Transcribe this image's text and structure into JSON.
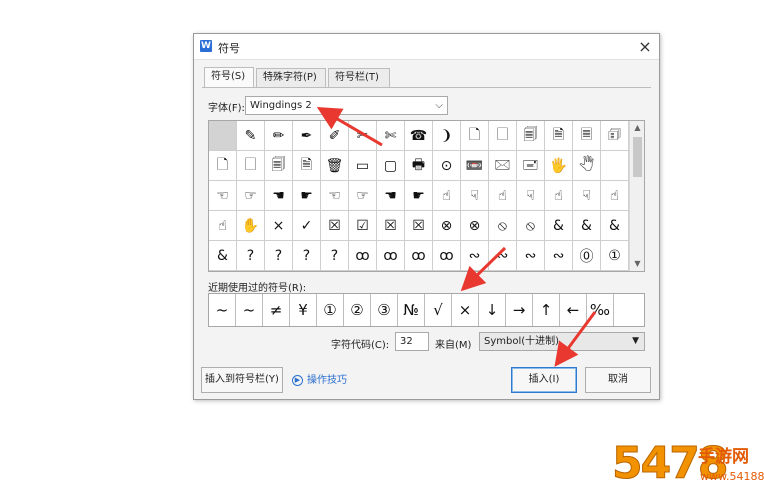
{
  "dialog": {
    "app_icon": "W",
    "title": "符号",
    "close_label": "×"
  },
  "tabs": [
    {
      "label": "符号(S)",
      "active": true
    },
    {
      "label": "特殊字符(P)",
      "active": false
    },
    {
      "label": "符号栏(T)",
      "active": false
    }
  ],
  "font": {
    "label": "字体(F):",
    "value": "Wingdings 2"
  },
  "symbol_grid": {
    "rows": [
      [
        "",
        "✎",
        "✏",
        "✒",
        "✐",
        "✂",
        "✄",
        "☎",
        "❩",
        "🗋",
        "🗌",
        "🗐",
        "🗎",
        "🗏",
        "🗊"
      ],
      [
        "🗋",
        "🗌",
        "🗐",
        "🗎",
        "🗑",
        "▭",
        "▢",
        "🖶",
        "⊙",
        "📼",
        "🖂",
        "🖃",
        "🖐",
        "🖑",
        ""
      ],
      [
        "☜",
        "☞",
        "☚",
        "☛",
        "☜",
        "☞",
        "☚",
        "☛",
        "☝",
        "☟",
        "☝",
        "☟",
        "☝",
        "☟",
        "☝"
      ],
      [
        "☝",
        "✋",
        "×",
        "✓",
        "☒",
        "☑",
        "☒",
        "☒",
        "⊗",
        "⊗",
        "⦸",
        "⦸",
        "&",
        "&",
        "&"
      ],
      [
        "&",
        "?",
        "?",
        "?",
        "?",
        "ꝏ",
        "ꝏ",
        "ꝏ",
        "ꝏ",
        "∾",
        "∾",
        "∾",
        "∾",
        "⓪",
        "①"
      ]
    ],
    "selected_index": 0
  },
  "recent": {
    "label": "近期使用过的符号(R):",
    "symbols": [
      "~",
      "~",
      "≠",
      "¥",
      "①",
      "②",
      "③",
      "№",
      "√",
      "×",
      "↓",
      "→",
      "↑",
      "←",
      "‰"
    ]
  },
  "char_code": {
    "label": "字符代码(C):",
    "value": "32",
    "from_label": "来自(M)",
    "from_value": "Symbol(十进制)"
  },
  "buttons": {
    "insert_to_bar": "插入到符号栏(Y)",
    "tips": "操作技巧",
    "insert": "插入(I)",
    "cancel": "取消"
  },
  "watermark": {
    "digits": "5478",
    "text": "手游网",
    "domain": "www.54188.com"
  },
  "colors": {
    "accent": "#2a6fcf",
    "arrow": "#e8382f",
    "watermark": "#f29200"
  }
}
